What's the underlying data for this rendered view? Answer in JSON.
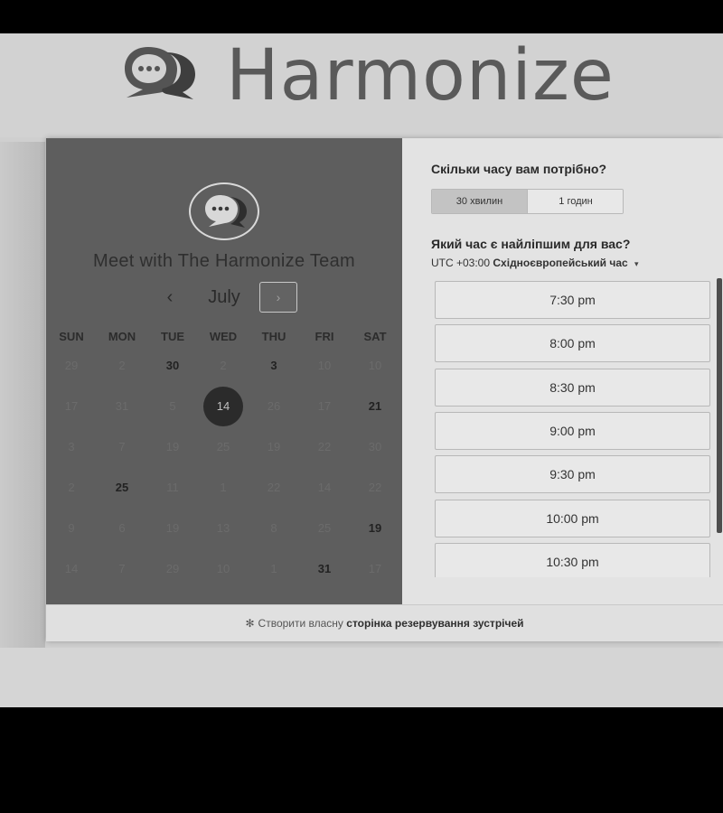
{
  "brand": {
    "name": "Harmonize",
    "logo_icon": "chat-bubble-icon"
  },
  "calendar": {
    "title": "Meet with The Harmonize Team",
    "month": "July",
    "prev_icon": "‹",
    "next_icon": "›",
    "weekdays": [
      "SUN",
      "MON",
      "TUE",
      "WED",
      "THU",
      "FRI",
      "SAT"
    ],
    "weeks": [
      [
        "29",
        "2",
        "30",
        "2",
        "3",
        "10",
        "10"
      ],
      [
        "17",
        "31",
        "5",
        "14",
        "26",
        "17",
        "21"
      ],
      [
        "3",
        "7",
        "19",
        "25",
        "19",
        "22",
        "30"
      ],
      [
        "2",
        "25",
        "11",
        "1",
        "22",
        "14",
        "22"
      ],
      [
        "9",
        "6",
        "19",
        "13",
        "8",
        "25",
        "19"
      ],
      [
        "14",
        "7",
        "29",
        "10",
        "1",
        "31",
        "17"
      ]
    ],
    "available": [
      [
        0,
        2
      ],
      [
        0,
        4
      ],
      [
        1,
        6
      ],
      [
        3,
        1
      ],
      [
        4,
        6
      ],
      [
        5,
        5
      ]
    ],
    "selected": [
      1,
      3
    ]
  },
  "booking": {
    "duration_question": "Скільки часу вам потрібно?",
    "duration_options": [
      "30 хвилин",
      "1 годин"
    ],
    "duration_selected": "30 хвилин",
    "time_question": "Який час є найліпшим для вас?",
    "timezone_offset": "UTC +03:00",
    "timezone_name": "Східноєвропейський час",
    "slots": [
      "7:30 pm",
      "8:00 pm",
      "8:30 pm",
      "9:00 pm",
      "9:30 pm",
      "10:00 pm",
      "10:30 pm"
    ]
  },
  "footer": {
    "icon": "hubspot-sprocket-icon",
    "text_plain": "Створити власну",
    "text_bold": "сторінка резервування зустрічей"
  }
}
